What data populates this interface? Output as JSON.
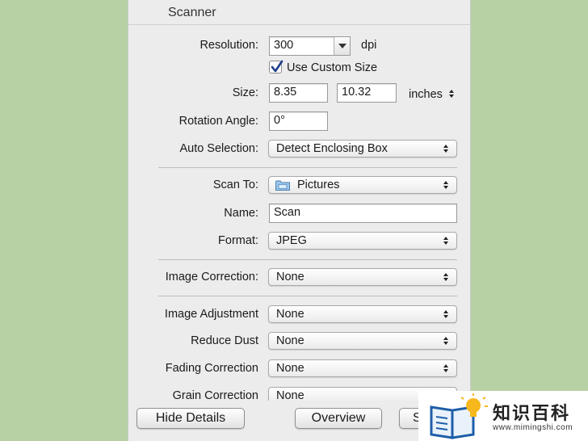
{
  "window": {
    "title": "Scanner"
  },
  "resolution": {
    "label": "Resolution:",
    "value": "300",
    "unit": "dpi"
  },
  "custom_size": {
    "label": "Use Custom Size",
    "checked": true
  },
  "size": {
    "label": "Size:",
    "width": "8.35",
    "height": "10.32",
    "unit": "inches"
  },
  "rotation": {
    "label": "Rotation Angle:",
    "value": "0°"
  },
  "auto_selection": {
    "label": "Auto Selection:",
    "value": "Detect Enclosing Box"
  },
  "scan_to": {
    "label": "Scan To:",
    "value": "Pictures",
    "icon": "folder-icon"
  },
  "name": {
    "label": "Name:",
    "value": "Scan"
  },
  "format": {
    "label": "Format:",
    "value": "JPEG"
  },
  "image_correction": {
    "label": "Image Correction:",
    "value": "None"
  },
  "image_adjustment": {
    "label": "Image Adjustment",
    "value": "None"
  },
  "reduce_dust": {
    "label": "Reduce Dust",
    "value": "None"
  },
  "fading_correction": {
    "label": "Fading Correction",
    "value": "None"
  },
  "grain_correction": {
    "label": "Grain Correction",
    "value": "None"
  },
  "buttons": {
    "hide_details": "Hide Details",
    "overview": "Overview",
    "scan": "Scan"
  },
  "watermark": {
    "name": "知识百科",
    "url": "www.mimingshi.com"
  },
  "colors": {
    "background": "#b8d1a4",
    "panel": "#ececec",
    "accent": "#2f8f66"
  }
}
